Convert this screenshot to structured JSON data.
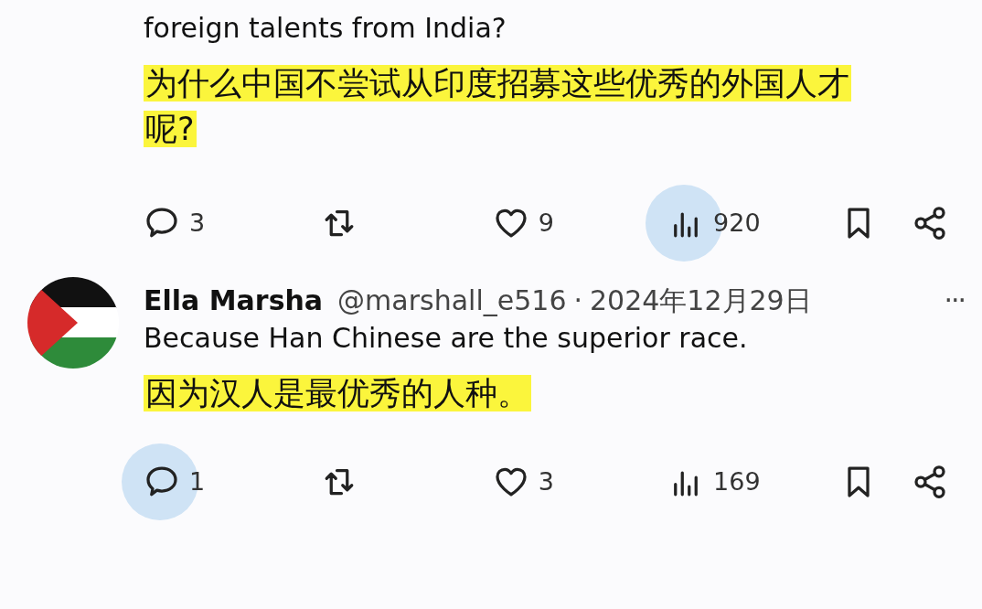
{
  "posts": [
    {
      "text": "foreign talents from India?",
      "translation": "为什么中国不尝试从印度招募这些优秀的外国人才呢?",
      "actions": [
        {
          "kind": "reply",
          "count": "3",
          "highlighted": false
        },
        {
          "kind": "repost",
          "highlighted": false
        },
        {
          "kind": "like",
          "count": "9",
          "highlighted": false
        },
        {
          "kind": "views",
          "count": "920",
          "highlighted": true
        },
        {
          "kind": "bookmark",
          "highlighted": false
        },
        {
          "kind": "share",
          "highlighted": false
        }
      ]
    },
    {
      "author": "Ella Marsha",
      "handle": "@marshall_e516",
      "separator": "·",
      "date": "2024年12月29日",
      "more": "···",
      "text": "Because Han Chinese are the superior race.",
      "translation": "因为汉人是最优秀的人种。",
      "actions": [
        {
          "kind": "reply",
          "count": "1",
          "highlighted": true
        },
        {
          "kind": "repost",
          "highlighted": false
        },
        {
          "kind": "like",
          "count": "3",
          "highlighted": false
        },
        {
          "kind": "views",
          "count": "169",
          "highlighted": false
        },
        {
          "kind": "bookmark",
          "highlighted": false
        },
        {
          "kind": "share",
          "highlighted": false
        }
      ]
    }
  ]
}
